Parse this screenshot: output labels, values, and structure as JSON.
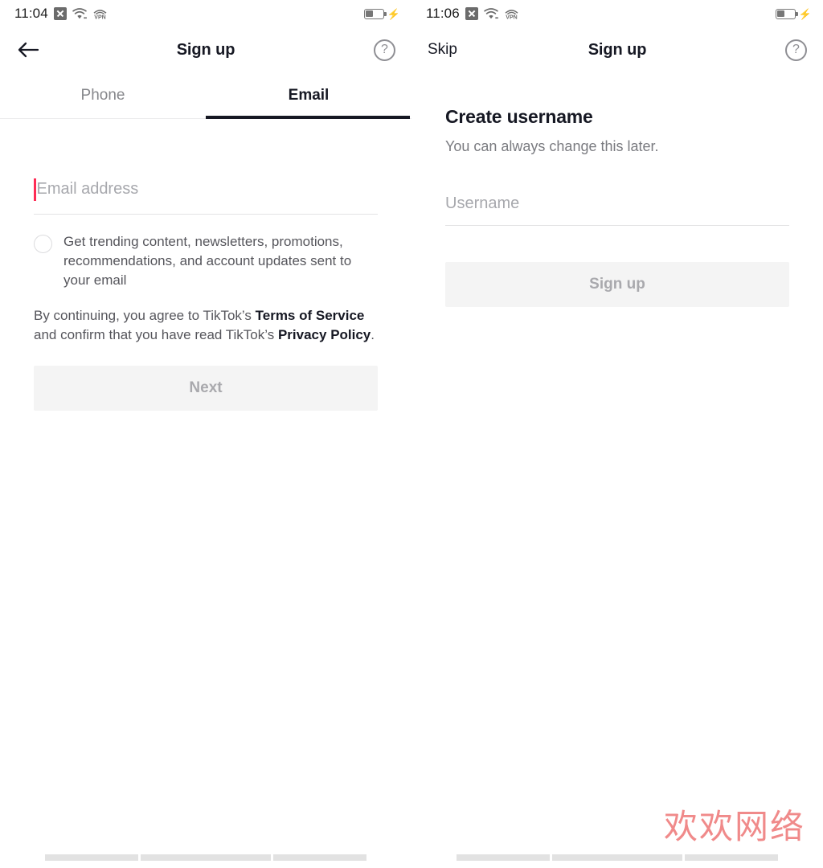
{
  "panels": [
    {
      "status": {
        "time": "11:04",
        "icons": [
          "x-message-icon",
          "wifi-icon",
          "vpn-icon"
        ],
        "battery_level_pct": 38,
        "charging": true
      },
      "nav": {
        "back_icon": "back-arrow-icon",
        "title": "Sign up",
        "help_icon": "help-circle-icon",
        "help_glyph": "?"
      },
      "tabs": [
        {
          "label": "Phone",
          "active": false
        },
        {
          "label": "Email",
          "active": true
        }
      ],
      "email_input": {
        "placeholder": "Email address",
        "value": "",
        "caret_color": "#fe2c55",
        "focused": true
      },
      "consent": {
        "checked": false,
        "text": "Get trending content, newsletters, promotions, recommendations, and account updates sent to your email"
      },
      "legal": {
        "part1": "By continuing, you agree to TikTok’s ",
        "link1": "Terms of Service",
        "part2": " and confirm that you have read TikTok’s ",
        "link2": "Privacy Policy",
        "part3": "."
      },
      "primary_button": {
        "label": "Next",
        "enabled": false
      }
    },
    {
      "status": {
        "time": "11:06",
        "icons": [
          "x-message-icon",
          "wifi-icon",
          "vpn-icon"
        ],
        "battery_level_pct": 38,
        "charging": true
      },
      "nav": {
        "skip_label": "Skip",
        "title": "Sign up",
        "help_icon": "help-circle-icon",
        "help_glyph": "?"
      },
      "section": {
        "title": "Create username",
        "subtitle": "You can always change this later."
      },
      "username_input": {
        "placeholder": "Username",
        "value": ""
      },
      "primary_button": {
        "label": "Sign up",
        "enabled": false
      }
    }
  ],
  "watermark": {
    "text": "欢欢网络",
    "color": "#f08a8a"
  },
  "theme": {
    "accent": "#fe2c55",
    "text_primary": "#161823",
    "text_secondary": "#86878b",
    "disabled_bg": "#f4f4f4",
    "disabled_text": "#a9a9ad"
  }
}
